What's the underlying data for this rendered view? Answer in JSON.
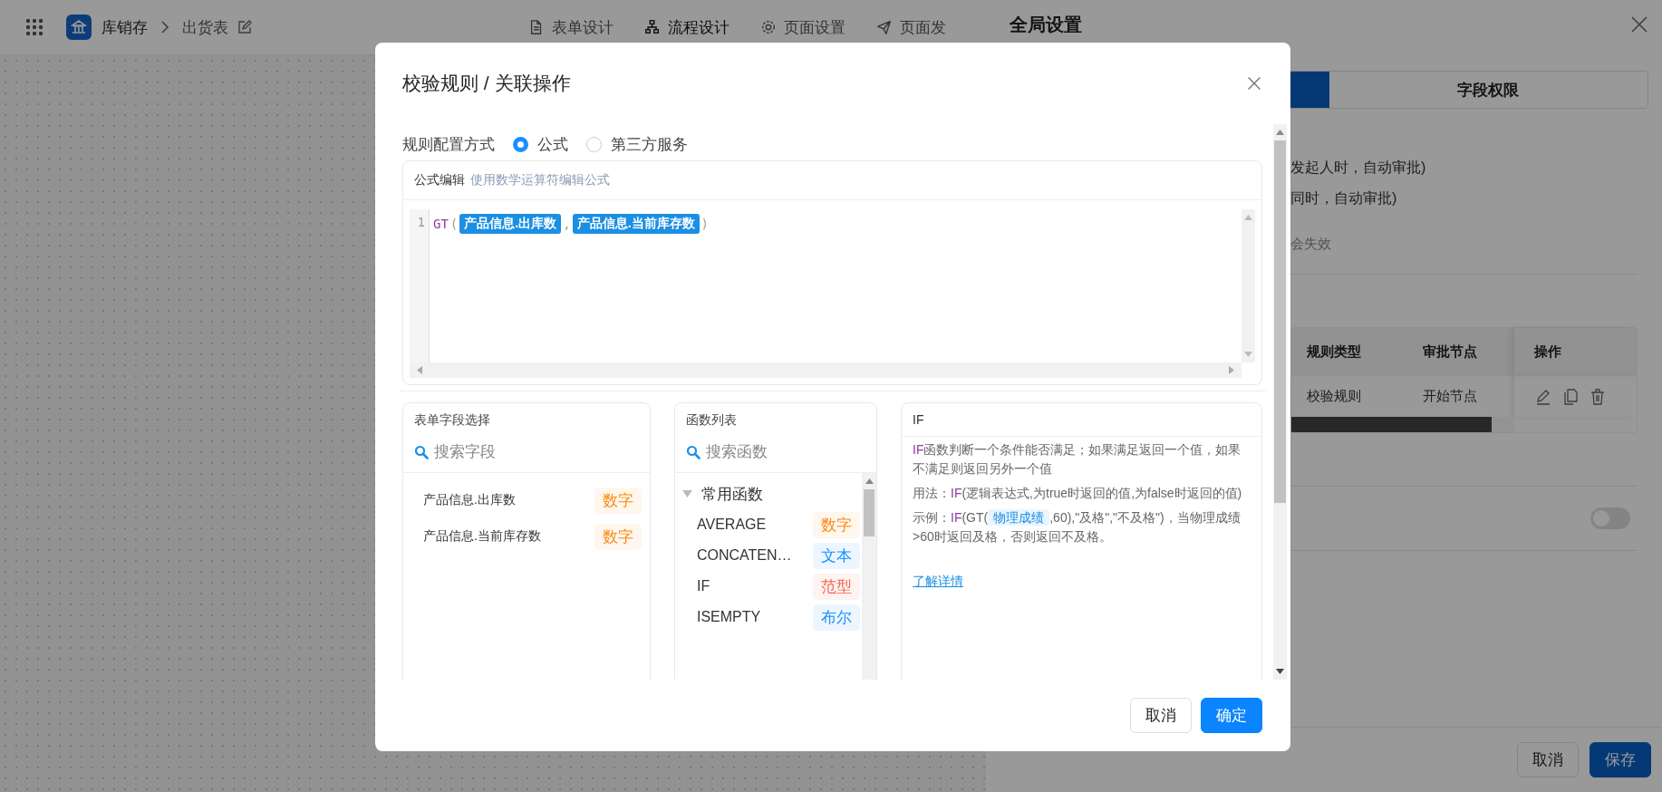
{
  "app_bar": {
    "app_name": "库销存",
    "page_name": "出货表",
    "tabs": [
      {
        "label": "表单设计",
        "selected": false
      },
      {
        "label": "流程设计",
        "selected": true
      },
      {
        "label": "页面设置",
        "selected": false
      },
      {
        "label": "页面发",
        "selected": false
      }
    ]
  },
  "drawer": {
    "title": "全局设置",
    "tabs": [
      {
        "selected": true
      },
      {
        "label": "字段权限",
        "selected": false
      }
    ],
    "notes": [
      {
        "text": "发起人时，自动审批)",
        "kind": "option"
      },
      {
        "text": "同时，自动审批)",
        "kind": "option"
      },
      {
        "text": "会失效",
        "kind": "hint"
      }
    ],
    "table": {
      "columns": [
        "规则类型",
        "审批节点",
        "操作"
      ],
      "rows": [
        {
          "cells": [
            "校验规则",
            "开始节点"
          ]
        }
      ]
    },
    "toggle": {
      "on": false
    },
    "buttons": [
      {
        "label": "取消",
        "kind": "default"
      },
      {
        "label": "保存",
        "kind": "primary"
      }
    ]
  },
  "dialog": {
    "title": "校验规则 / 关联操作",
    "mode_label": "规则配置方式",
    "modes": [
      {
        "label": "公式",
        "selected": true
      },
      {
        "label": "第三方服务",
        "selected": false
      }
    ],
    "editor": {
      "title": "公式编辑",
      "hint": "使用数学运算符编辑公式",
      "lines": [
        {
          "number": "1",
          "tokens": [
            {
              "kind": "func",
              "text": "GT"
            },
            {
              "kind": "punct",
              "text": "("
            },
            {
              "kind": "field",
              "text": "产品信息.出库数"
            },
            {
              "kind": "punct",
              "text": ","
            },
            {
              "kind": "field",
              "text": "产品信息.当前库存数"
            },
            {
              "kind": "punct",
              "text": ")"
            }
          ]
        }
      ]
    },
    "field_panel": {
      "title": "表单字段选择",
      "placeholder": "搜索字段",
      "items": [
        {
          "name": "产品信息.出库数",
          "type": "数字",
          "color": "#fa8c16"
        },
        {
          "name": "产品信息.当前库存数",
          "type": "数字",
          "color": "#fa8c16"
        }
      ]
    },
    "function_panel": {
      "title": "函数列表",
      "placeholder": "搜索函数",
      "groups": [
        {
          "name": "常用函数",
          "expanded": true,
          "items": [
            {
              "name": "AVERAGE",
              "type": "数字",
              "color": "#fa8c16"
            },
            {
              "name": "CONCATEN…",
              "type": "文本",
              "color": "#1890ff"
            },
            {
              "name": "IF",
              "type": "范型",
              "color": "#f5634a"
            },
            {
              "name": "ISEMPTY",
              "type": "布尔",
              "color": "#1890ff"
            }
          ]
        }
      ]
    },
    "doc_panel": {
      "title": "IF",
      "paragraphs": [
        [
          {
            "kind": "fn",
            "text": "IF"
          },
          {
            "kind": "text",
            "text": "函数判断一个条件能否满足；如果满足返回一个值，如果不满足则返回另外一个值"
          }
        ],
        [
          {
            "kind": "text",
            "text": "用法："
          },
          {
            "kind": "fn",
            "text": "IF"
          },
          {
            "kind": "text",
            "text": "(逻辑表达式,为true时返回的值,为false时返回的值)"
          }
        ],
        [
          {
            "kind": "text",
            "text": "示例："
          },
          {
            "kind": "fn",
            "text": "IF"
          },
          {
            "kind": "text",
            "text": "(GT("
          },
          {
            "kind": "field",
            "text": "物理成绩"
          },
          {
            "kind": "text",
            "text": ",60),\"及格\",\"不及格\")，当物理成绩>60时返回及格，否则返回不及格。"
          }
        ]
      ],
      "link": "了解详情"
    },
    "buttons": [
      {
        "label": "取消",
        "kind": "default"
      },
      {
        "label": "确定",
        "kind": "primary"
      }
    ]
  }
}
